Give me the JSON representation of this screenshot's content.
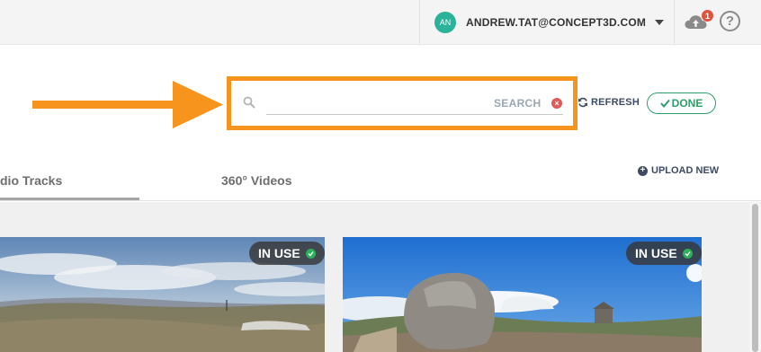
{
  "header": {
    "avatar_initials": "AN",
    "account_email": "ANDREW.TAT@CONCEPT3D.COM",
    "notification_count": "1",
    "help_glyph": "?",
    "icons": [
      "caret-down-icon",
      "cloud-upload-icon",
      "help-icon"
    ]
  },
  "search": {
    "value": "",
    "placeholder": "",
    "label": "SEARCH",
    "clear_glyph": "×"
  },
  "toolbar": {
    "refresh_label": "REFRESH",
    "done_label": "DONE"
  },
  "tabs": [
    {
      "label": "dio Tracks",
      "active": true
    },
    {
      "label": "360° Videos",
      "active": false
    }
  ],
  "upload": {
    "icon_glyph": "+",
    "label": "UPLOAD NEW"
  },
  "cards": [
    {
      "badge": "IN USE",
      "status_icon": "check-circle-icon"
    },
    {
      "badge": "IN USE",
      "status_icon": "check-circle-icon"
    }
  ],
  "colors": {
    "annotation_orange": "#f7941d",
    "avatar_teal": "#2bb39a",
    "done_green": "#2e9e6a",
    "clear_red": "#e05a5a",
    "badge_green": "#2cb15a"
  }
}
